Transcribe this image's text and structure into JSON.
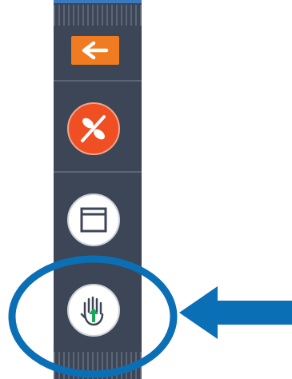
{
  "toolbar": {
    "buttons": [
      {
        "id": "back",
        "icon": "arrow-left-icon",
        "color": "#f07b20"
      },
      {
        "id": "stop-sharing",
        "icon": "slashed-circles-icon",
        "color": "#f04e23"
      },
      {
        "id": "window",
        "icon": "window-icon",
        "color": "#ffffff"
      },
      {
        "id": "raise-hand",
        "icon": "raise-hand-icon",
        "color": "#ffffff",
        "highlighted": true
      }
    ],
    "background": "#3c4656"
  },
  "annotation": {
    "circle_color": "#0b6fb5",
    "arrow_color": "#0b6fb5",
    "points_to": "raise-hand"
  }
}
